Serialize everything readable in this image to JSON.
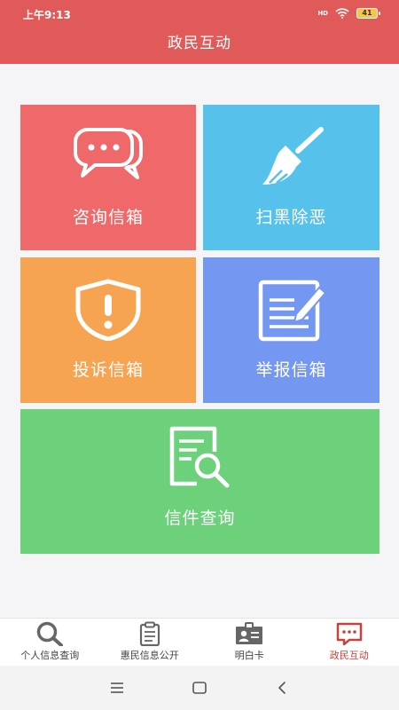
{
  "status_bar": {
    "time": "上午9:13",
    "network_label": "HD",
    "battery": "41"
  },
  "header": {
    "title": "政民互动"
  },
  "tiles": [
    {
      "label": "咨询信箱",
      "icon": "chat-bubbles-icon",
      "color": "#f0696a"
    },
    {
      "label": "扫黑除恶",
      "icon": "broom-icon",
      "color": "#56c2ec"
    },
    {
      "label": "投诉信箱",
      "icon": "shield-alert-icon",
      "color": "#f7a452"
    },
    {
      "label": "举报信箱",
      "icon": "edit-document-icon",
      "color": "#7497f1"
    },
    {
      "label": "信件查询",
      "icon": "document-search-icon",
      "color": "#6dd17c"
    }
  ],
  "bottom_nav": [
    {
      "label": "个人信息查询",
      "icon": "search-icon",
      "active": false
    },
    {
      "label": "惠民信息公开",
      "icon": "clipboard-icon",
      "active": false
    },
    {
      "label": "明白卡",
      "icon": "id-card-icon",
      "active": false
    },
    {
      "label": "政民互动",
      "icon": "message-icon",
      "active": true
    }
  ],
  "system_nav": [
    "menu-icon",
    "home-icon",
    "back-icon"
  ],
  "colors": {
    "accent": "#e05a5a",
    "active_nav": "#c9413d"
  }
}
